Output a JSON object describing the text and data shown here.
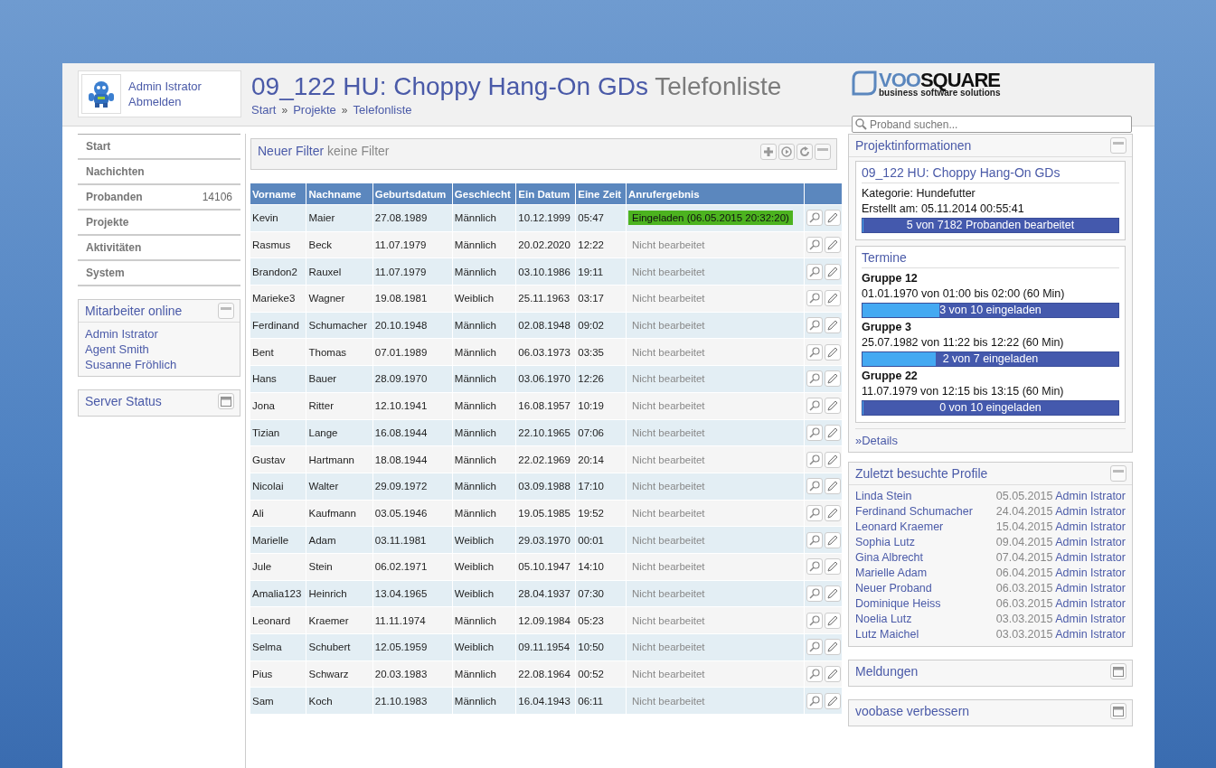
{
  "user": {
    "name": "Admin Istrator",
    "logout": "Abmelden"
  },
  "title": {
    "project": "09_122 HU: Choppy Hang-On GDs",
    "page": "Telefonliste"
  },
  "breadcrumb": [
    "Start",
    "Projekte",
    "Telefonliste"
  ],
  "breadcrumb_separator": "»",
  "logo": {
    "part1": "VOO",
    "part2": "SQUARE",
    "tagline": "business software solutions"
  },
  "search": {
    "placeholder": "Proband suchen..."
  },
  "nav": [
    {
      "label": "Start"
    },
    {
      "label": "Nachichten"
    },
    {
      "label": "Probanden",
      "count": "14106"
    },
    {
      "label": "Projekte"
    },
    {
      "label": "Aktivitäten"
    },
    {
      "label": "System"
    }
  ],
  "staff_panel": {
    "title": "Mitarbeiter online",
    "expanded": true,
    "items": [
      "Admin Istrator",
      "Agent Smith",
      "Susanne Fröhlich"
    ]
  },
  "server_panel": {
    "title": "Server Status",
    "expanded": false
  },
  "filter": {
    "title": "Neuer Filter",
    "value": "keine Filter"
  },
  "table": {
    "columns": [
      "Vorname",
      "Nachname",
      "Geburtsdatum",
      "Geschlecht",
      "Ein Datum",
      "Eine Zeit",
      "Anrufergebnis"
    ],
    "rows": [
      {
        "cells": [
          "Kevin",
          "Maier",
          "27.08.1989",
          "Männlich",
          "10.12.1999",
          "05:47"
        ],
        "result": "Eingeladen (06.05.2015 20:32:20)",
        "kind": "invited"
      },
      {
        "cells": [
          "Rasmus",
          "Beck",
          "11.07.1979",
          "Männlich",
          "20.02.2020",
          "12:22"
        ],
        "result": "Nicht bearbeitet",
        "kind": "open"
      },
      {
        "cells": [
          "Brandon2",
          "Rauxel",
          "11.07.1979",
          "Männlich",
          "03.10.1986",
          "19:11"
        ],
        "result": "Nicht bearbeitet",
        "kind": "open"
      },
      {
        "cells": [
          "Marieke3",
          "Wagner",
          "19.08.1981",
          "Weiblich",
          "25.11.1963",
          "03:17"
        ],
        "result": "Nicht bearbeitet",
        "kind": "open"
      },
      {
        "cells": [
          "Ferdinand",
          "Schumacher",
          "20.10.1948",
          "Männlich",
          "02.08.1948",
          "09:02"
        ],
        "result": "Nicht bearbeitet",
        "kind": "open"
      },
      {
        "cells": [
          "Bent",
          "Thomas",
          "07.01.1989",
          "Männlich",
          "06.03.1973",
          "03:35"
        ],
        "result": "Nicht bearbeitet",
        "kind": "open"
      },
      {
        "cells": [
          "Hans",
          "Bauer",
          "28.09.1970",
          "Männlich",
          "03.06.1970",
          "12:26"
        ],
        "result": "Nicht bearbeitet",
        "kind": "open"
      },
      {
        "cells": [
          "Jona",
          "Ritter",
          "12.10.1941",
          "Männlich",
          "16.08.1957",
          "10:19"
        ],
        "result": "Nicht bearbeitet",
        "kind": "open"
      },
      {
        "cells": [
          "Tizian",
          "Lange",
          "16.08.1944",
          "Männlich",
          "22.10.1965",
          "07:06"
        ],
        "result": "Nicht bearbeitet",
        "kind": "open"
      },
      {
        "cells": [
          "Gustav",
          "Hartmann",
          "18.08.1944",
          "Männlich",
          "22.02.1969",
          "20:14"
        ],
        "result": "Nicht bearbeitet",
        "kind": "open"
      },
      {
        "cells": [
          "Nicolai",
          "Walter",
          "29.09.1972",
          "Männlich",
          "03.09.1988",
          "17:10"
        ],
        "result": "Nicht bearbeitet",
        "kind": "open"
      },
      {
        "cells": [
          "Ali",
          "Kaufmann",
          "03.05.1946",
          "Männlich",
          "19.05.1985",
          "19:52"
        ],
        "result": "Nicht bearbeitet",
        "kind": "open"
      },
      {
        "cells": [
          "Marielle",
          "Adam",
          "03.11.1981",
          "Weiblich",
          "29.03.1970",
          "00:01"
        ],
        "result": "Nicht bearbeitet",
        "kind": "open"
      },
      {
        "cells": [
          "Jule",
          "Stein",
          "06.02.1971",
          "Weiblich",
          "05.10.1947",
          "14:10"
        ],
        "result": "Nicht bearbeitet",
        "kind": "open"
      },
      {
        "cells": [
          "Amalia123",
          "Heinrich",
          "13.04.1965",
          "Weiblich",
          "28.04.1937",
          "07:30"
        ],
        "result": "Nicht bearbeitet",
        "kind": "open"
      },
      {
        "cells": [
          "Leonard",
          "Kraemer",
          "11.11.1974",
          "Männlich",
          "12.09.1984",
          "05:23"
        ],
        "result": "Nicht bearbeitet",
        "kind": "open"
      },
      {
        "cells": [
          "Selma",
          "Schubert",
          "12.05.1959",
          "Weiblich",
          "09.11.1954",
          "10:50"
        ],
        "result": "Nicht bearbeitet",
        "kind": "open"
      },
      {
        "cells": [
          "Pius",
          "Schwarz",
          "20.03.1983",
          "Männlich",
          "22.08.1964",
          "00:52"
        ],
        "result": "Nicht bearbeitet",
        "kind": "open"
      },
      {
        "cells": [
          "Sam",
          "Koch",
          "21.10.1983",
          "Männlich",
          "16.04.1943",
          "06:11"
        ],
        "result": "Nicht bearbeitet",
        "kind": "open"
      }
    ]
  },
  "project_panel": {
    "title": "Projektinformationen",
    "expanded": true,
    "name": "09_122 HU: Choppy Hang-On GDs",
    "category": "Kategorie: Hundefutter",
    "created": "Erstellt am: 05.11.2014 00:55:41",
    "progress": {
      "label": "5 von 7182 Probanden bearbeitet",
      "level": 0.001
    },
    "appointments_title": "Termine",
    "appointments": [
      {
        "group": "Gruppe 12",
        "time": "01.01.1970 von 01:00 bis 02:00 (60 Min)",
        "label": "3 von 10 eingeladen",
        "level": 0.3
      },
      {
        "group": "Gruppe 3",
        "time": "25.07.1982 von 11:22 bis 12:22 (60 Min)",
        "label": "2 von 7 eingeladen",
        "level": 0.286
      },
      {
        "group": "Gruppe 22",
        "time": "11.07.1979 von 12:15 bis 13:15 (60 Min)",
        "label": "0 von 10 eingeladen",
        "level": 0.0
      }
    ],
    "details_marker": "»",
    "details": "Details"
  },
  "recent_panel": {
    "title": "Zuletzt besuchte Profile",
    "expanded": true,
    "items": [
      {
        "name": "Linda Stein",
        "date": "05.05.2015",
        "user": "Admin Istrator"
      },
      {
        "name": "Ferdinand Schumacher",
        "date": "24.04.2015",
        "user": "Admin Istrator"
      },
      {
        "name": "Leonard Kraemer",
        "date": "15.04.2015",
        "user": "Admin Istrator"
      },
      {
        "name": "Sophia Lutz",
        "date": "09.04.2015",
        "user": "Admin Istrator"
      },
      {
        "name": "Gina Albrecht",
        "date": "07.04.2015",
        "user": "Admin Istrator"
      },
      {
        "name": "Marielle Adam",
        "date": "06.04.2015",
        "user": "Admin Istrator"
      },
      {
        "name": "Neuer Proband",
        "date": "06.03.2015",
        "user": "Admin Istrator"
      },
      {
        "name": "Dominique Heiss",
        "date": "06.03.2015",
        "user": "Admin Istrator"
      },
      {
        "name": "Noelia Lutz",
        "date": "03.03.2015",
        "user": "Admin Istrator"
      },
      {
        "name": "Lutz Maichel",
        "date": "03.03.2015",
        "user": "Admin Istrator"
      }
    ]
  },
  "collapsed_panels": [
    {
      "title": "Meldungen",
      "expanded": false
    },
    {
      "title": "voobase verbessern",
      "expanded": false
    }
  ]
}
